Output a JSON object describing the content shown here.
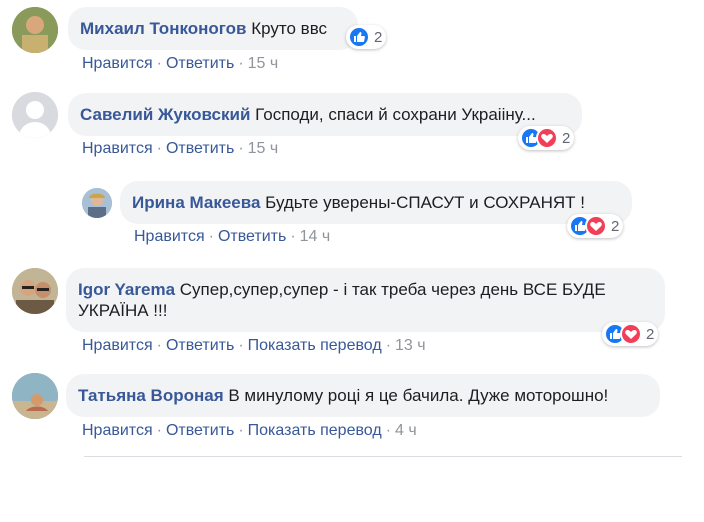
{
  "actions": {
    "like": "Нравится",
    "reply": "Ответить",
    "translate": "Показать перевод",
    "sep": "·"
  },
  "comments": [
    {
      "author": "Михаил Тонконогов",
      "text": "Круто ввс",
      "time": "15 ч",
      "reactions": [
        "like"
      ],
      "count": "2"
    },
    {
      "author": "Савелий Жуковский",
      "text": "Господи, спаси й сохрани Украiiну...",
      "time": "15 ч",
      "reactions": [
        "like",
        "love"
      ],
      "count": "2"
    },
    {
      "author": "Ирина Макеева",
      "text": "Будьте уверены-СПАСУТ и СОХРАНЯТ !",
      "time": "14 ч",
      "reactions": [
        "like",
        "love"
      ],
      "count": "2"
    },
    {
      "author": "Igor Yarema",
      "text": "Супер,супер,супер - і так треба через день ВСЕ БУДЕ УКРАЇНА !!!",
      "time": "13 ч",
      "reactions": [
        "like",
        "love"
      ],
      "count": "2"
    },
    {
      "author": "Татьяна Вороная",
      "text": "В минулому році я це бачила. Дуже моторошно!",
      "time": "4 ч",
      "reactions": [],
      "count": ""
    }
  ],
  "colors": {
    "link": "#385898",
    "like": "#1877f2",
    "love": "#f33e58",
    "bubble": "#f2f3f5"
  },
  "icons": {
    "like": "thumbs-up-icon",
    "love": "heart-icon"
  }
}
